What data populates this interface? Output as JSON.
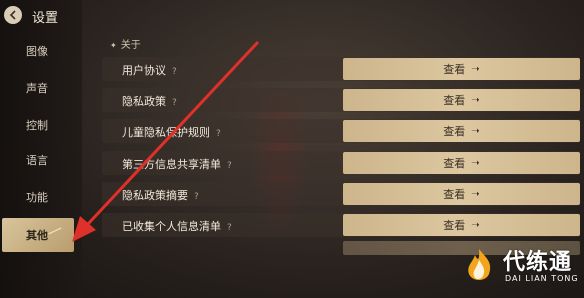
{
  "header": {
    "title": "设置"
  },
  "sidebar": {
    "items": [
      {
        "label": "图像",
        "active": false
      },
      {
        "label": "声音",
        "active": false
      },
      {
        "label": "控制",
        "active": false
      },
      {
        "label": "语言",
        "active": false
      },
      {
        "label": "功能",
        "active": false
      },
      {
        "label": "其他",
        "active": true
      }
    ]
  },
  "main": {
    "section_title": "关于",
    "rows": [
      {
        "label": "用户协议",
        "help": "?",
        "button": "查看"
      },
      {
        "label": "隐私政策",
        "help": "?",
        "button": "查看"
      },
      {
        "label": "儿童隐私保护规则",
        "help": "?",
        "button": "查看"
      },
      {
        "label": "第三方信息共享清单",
        "help": "?",
        "button": "查看"
      },
      {
        "label": "隐私政策摘要",
        "help": "?",
        "button": "查看"
      },
      {
        "label": "已收集个人信息清单",
        "help": "?",
        "button": "查看"
      }
    ]
  },
  "watermark": {
    "brand": "代练通",
    "sub": "DAI LIAN TONG"
  },
  "colors": {
    "accent_gold": "#d4bf96",
    "annotation_red": "#e0302a",
    "active_text": "#2b241c"
  }
}
